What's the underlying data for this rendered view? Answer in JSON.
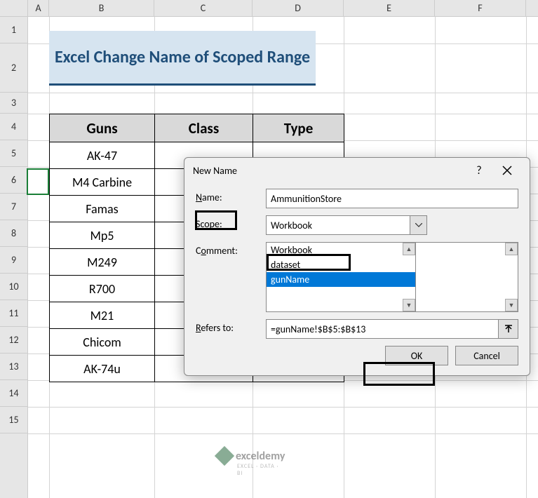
{
  "columns": [
    "A",
    "B",
    "C",
    "D",
    "E",
    "F"
  ],
  "rows": [
    "1",
    "2",
    "3",
    "4",
    "5",
    "6",
    "7",
    "8",
    "9",
    "10",
    "11",
    "12",
    "13",
    "14",
    "15"
  ],
  "title": "Excel Change Name of Scoped Range",
  "table": {
    "headers": [
      "Guns",
      "Class",
      "Type"
    ],
    "data": [
      [
        "AK-47",
        "",
        ""
      ],
      [
        "M4 Carbine",
        "",
        ""
      ],
      [
        "Famas",
        "",
        ""
      ],
      [
        "Mp5",
        "",
        ""
      ],
      [
        "M249",
        "",
        ""
      ],
      [
        "R700",
        "",
        ""
      ],
      [
        "M21",
        "",
        ""
      ],
      [
        "Chicom",
        "",
        ""
      ],
      [
        "AK-74u",
        "",
        ""
      ]
    ]
  },
  "dialog": {
    "title": "New Name",
    "name_label": "Name:",
    "name_value": "AmmunitionStore",
    "scope_label": "Scope:",
    "scope_value": "Workbook",
    "scope_options": [
      "Workbook",
      "dataset",
      "gunName"
    ],
    "scope_selected_index": 2,
    "comment_label": "Comment:",
    "refers_label": "Refers to:",
    "refers_value": "=gunName!$B$5:$B$13",
    "ok": "OK",
    "cancel": "Cancel",
    "help": "?"
  },
  "watermark": {
    "brand": "exceldemy",
    "tag": "EXCEL · DATA · BI"
  }
}
